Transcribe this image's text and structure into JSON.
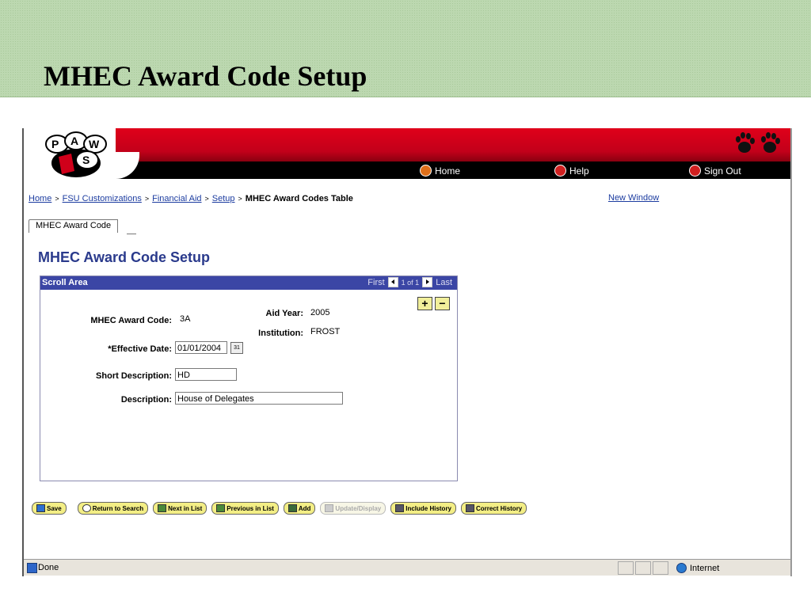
{
  "slide": {
    "title": "MHEC Award Code Setup"
  },
  "nav": {
    "home": "Home",
    "help": "Help",
    "sign_out": "Sign Out"
  },
  "breadcrumb": {
    "items": [
      "Home",
      "FSU Customizations",
      "Financial Aid",
      "Setup"
    ],
    "separator": ">",
    "current": "MHEC Award Codes Table"
  },
  "new_window": "New Window",
  "tab": {
    "label": "MHEC Award Code"
  },
  "page": {
    "title": "MHEC Award Code Setup"
  },
  "scroll_area": {
    "title": "Scroll Area",
    "first": "First",
    "of_text": "1 of 1",
    "last": "Last",
    "add": "+",
    "remove": "−"
  },
  "form": {
    "award_code_label": "MHEC Award Code:",
    "award_code_value": "3A",
    "aid_year_label": "Aid Year:",
    "aid_year_value": "2005",
    "institution_label": "Institution:",
    "institution_value": "FROST",
    "effective_date_label": "*Effective Date:",
    "effective_date_value": "01/01/2004",
    "calendar_glyph": "31",
    "short_desc_label": "Short Description:",
    "short_desc_value": "HD",
    "desc_label": "Description:",
    "desc_value": "House of Delegates"
  },
  "buttons": {
    "save": "Save",
    "return_to_search": "Return to Search",
    "next_in_list": "Next in List",
    "previous_in_list": "Previous in List",
    "add": "Add",
    "update_display": "Update/Display",
    "include_history": "Include History",
    "correct_history": "Correct History"
  },
  "status": {
    "done": "Done",
    "zone": "Internet"
  },
  "colors": {
    "banner_red": "#c2001a",
    "link_blue": "#1c3ca0",
    "title_blue": "#2a3a8c",
    "scroll_head": "#3b46a5",
    "button_yellow": "#f3ee85"
  }
}
